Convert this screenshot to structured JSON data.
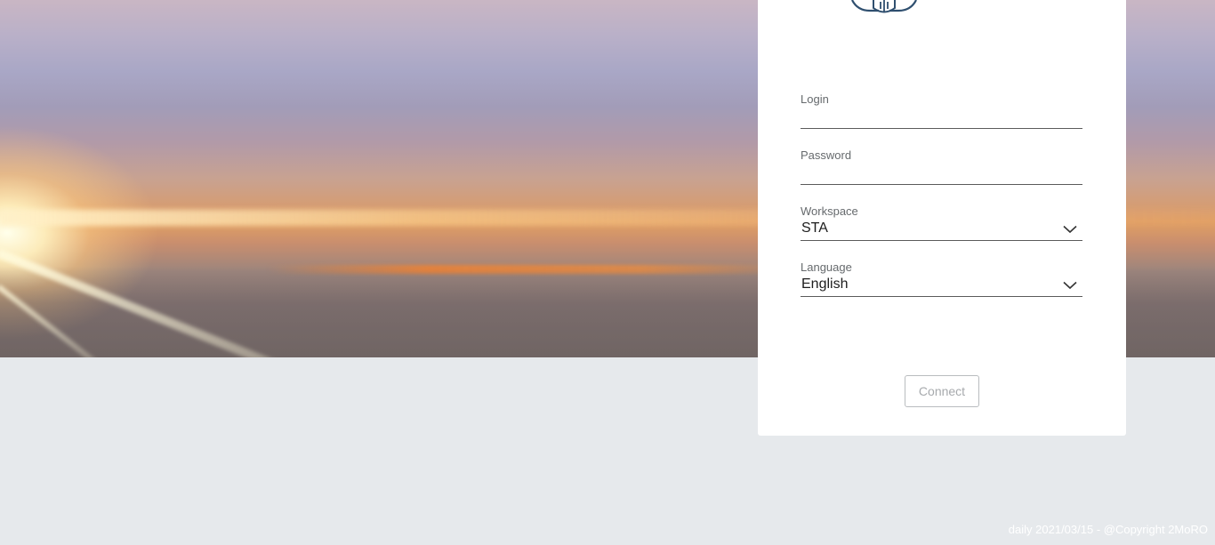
{
  "login_form": {
    "login_label": "Login",
    "login_value": "",
    "password_label": "Password",
    "password_value": "",
    "workspace_label": "Workspace",
    "workspace_selected": "STA",
    "language_label": "Language",
    "language_selected": "English",
    "connect_label": "Connect"
  },
  "icons": {
    "logo": "company-logo",
    "workspace_dropdown": "chevron-down-icon",
    "language_dropdown": "chevron-down-icon"
  },
  "footer": {
    "text": "daily 2021/03/15 - @Copyright 2MoRO"
  },
  "colors": {
    "page_background": "#e6e9ec",
    "card_background": "#ffffff",
    "label": "#666a6d",
    "button_border": "#b9bcbf",
    "button_text": "#a7aaad",
    "logo": "#2f4f6f"
  }
}
